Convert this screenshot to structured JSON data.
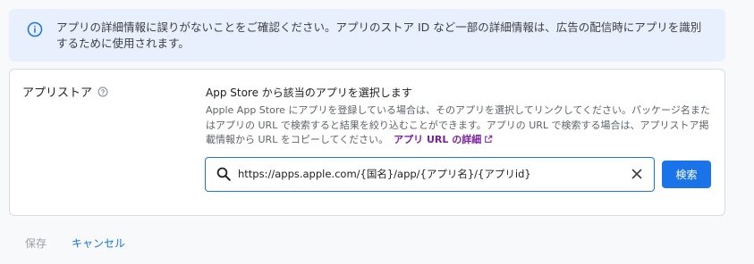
{
  "info_banner": {
    "icon": "info-icon",
    "text": "アプリの詳細情報に誤りがないことをご確認ください。アプリのストア ID など一部の詳細情報は、広告の配信時にアプリを識別するために使用されます。"
  },
  "app_store_section": {
    "label": "アプリストア",
    "help_icon": "help-icon",
    "select_title": "App Store から該当のアプリを選択します",
    "description": "Apple App Store にアプリを登録している場合は、そのアプリを選択してリンクしてください。パッケージ名またはアプリの URL で検索すると結果を絞り込むことができます。アプリの URL で検索する場合は、アプリストア掲載情報から URL をコピーしてください。",
    "details_link": "アプリ URL の詳細",
    "link_icon": "external-link-icon"
  },
  "search": {
    "icon": "search-icon",
    "value": "https://apps.apple.com/{国名}/app/{アプリ名}/{アプリid}",
    "clear_icon": "close-icon",
    "button_label": "検索"
  },
  "footer": {
    "save_label": "保存",
    "cancel_label": "キャンセル"
  },
  "colors": {
    "accent": "#1a73e8",
    "link": "#7b1fa2",
    "banner_bg": "#e8f0fe"
  }
}
